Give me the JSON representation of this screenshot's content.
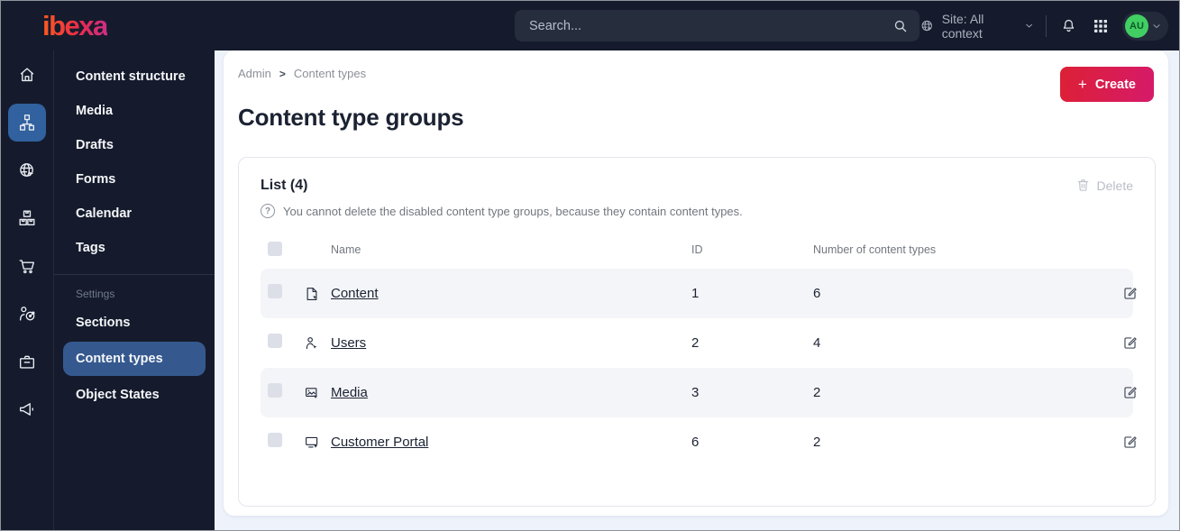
{
  "topbar": {
    "logo": "ibexa",
    "search": {
      "placeholder": "Search..."
    },
    "site_selector": {
      "label": "Site: All context"
    },
    "user": {
      "avatar_initials": "AU"
    }
  },
  "menu": {
    "items": [
      "Content structure",
      "Media",
      "Drafts",
      "Forms",
      "Calendar",
      "Tags"
    ],
    "section_header": "Settings",
    "settings_items": [
      "Sections",
      "Content types",
      "Object States"
    ],
    "active_item": "Content types"
  },
  "main": {
    "breadcrumb": {
      "root": "Admin",
      "separator": ">",
      "current": "Content types"
    },
    "create_button": {
      "plus": "+",
      "label": "Create"
    },
    "page_title": "Content type groups",
    "list_card": {
      "title": "List (4)",
      "note": "You cannot delete the disabled content type groups, because they contain content types.",
      "delete_button": "Delete",
      "table": {
        "columns": {
          "name": "Name",
          "id": "ID",
          "count": "Number of content types"
        },
        "rows": [
          {
            "icon": "content-file-icon",
            "name": "Content",
            "id": "1",
            "count": "6"
          },
          {
            "icon": "user-icon",
            "name": "Users",
            "id": "2",
            "count": "4"
          },
          {
            "icon": "media-image-icon",
            "name": "Media",
            "id": "3",
            "count": "2"
          },
          {
            "icon": "portal-monitor-icon",
            "name": "Customer Portal",
            "id": "6",
            "count": "2"
          }
        ]
      }
    }
  },
  "colors": {
    "topbar_bg": "#151b2c",
    "rail_active_blue": "#31619e",
    "menu_active_blue": "#35598f",
    "accent_gradient_start": "#dc2035",
    "accent_gradient_end": "#d61a6a",
    "avatar_green": "#41cf63",
    "page_bg": "#edf2fb",
    "stripe_bg": "#f4f5f8",
    "text_dark": "#1b2232",
    "text_muted": "#72777f"
  }
}
